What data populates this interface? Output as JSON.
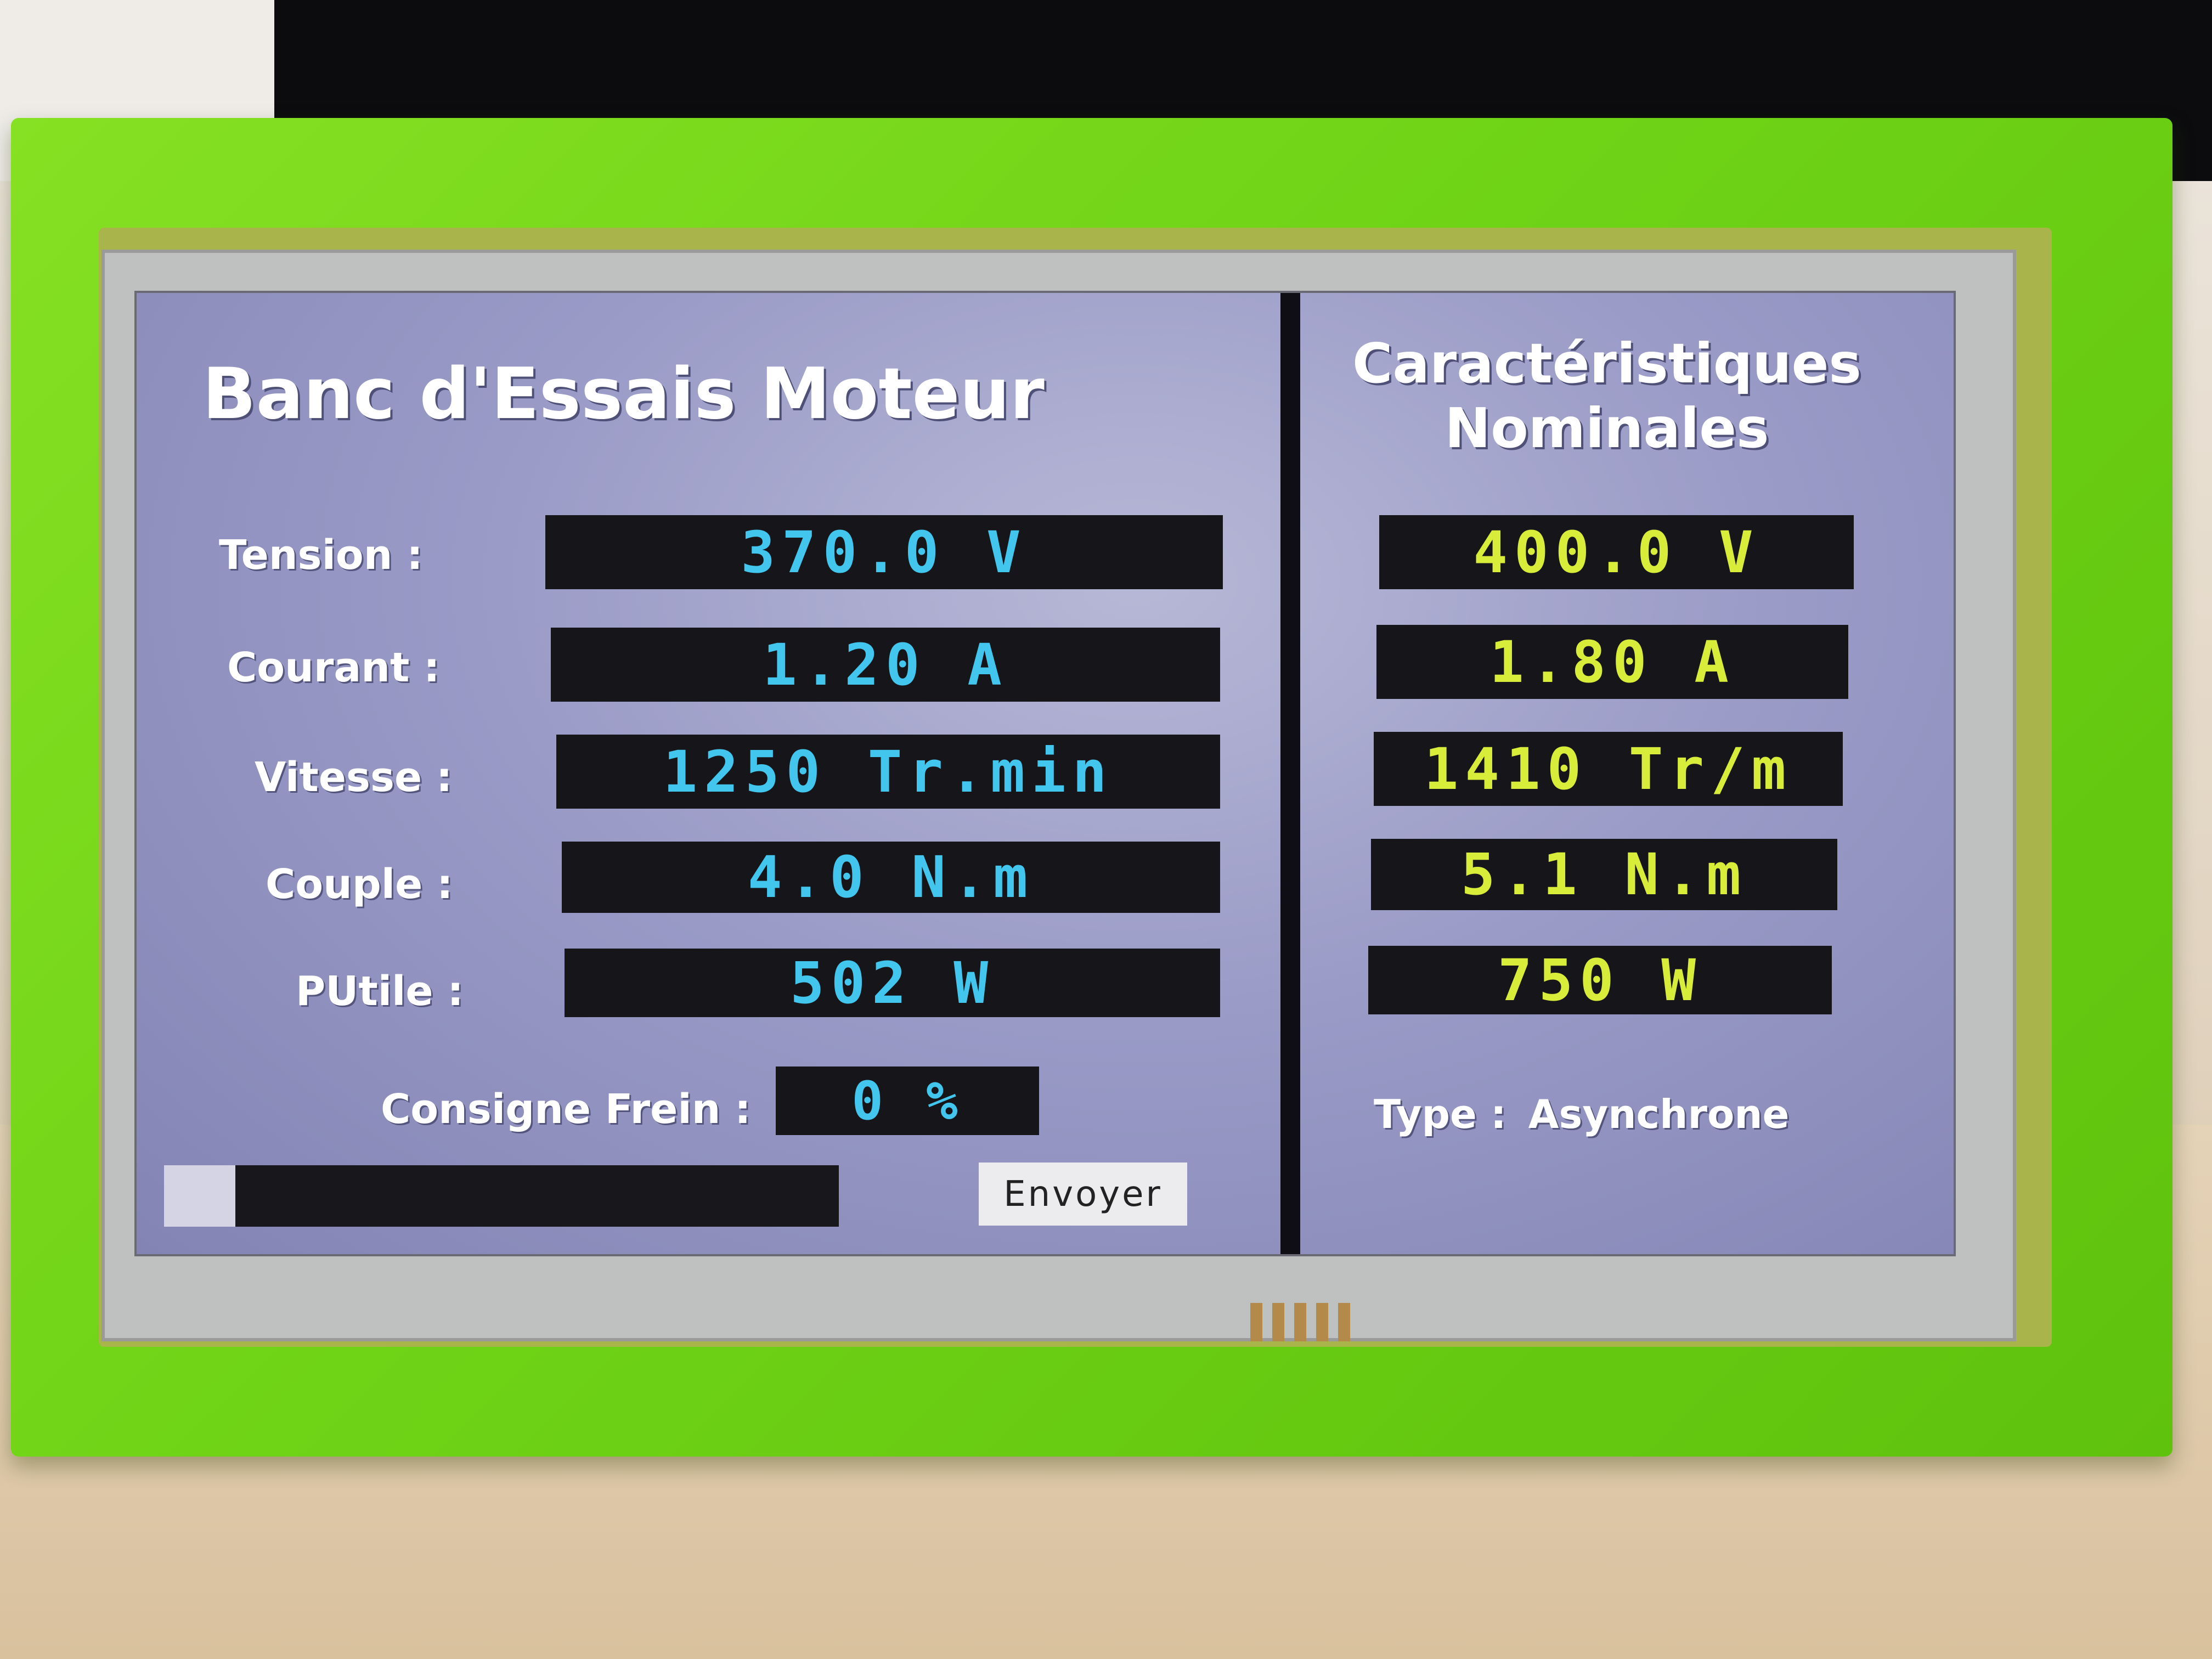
{
  "app": {
    "title": "Banc d'Essais Moteur",
    "side_title_line1": "Caractéristiques",
    "side_title_line2": "Nominales"
  },
  "measured": {
    "tension": {
      "label": "Tension :",
      "value": "370.0 V"
    },
    "courant": {
      "label": "Courant :",
      "value": "1.20 A"
    },
    "vitesse": {
      "label": "Vitesse :",
      "value": "1250 Tr.min"
    },
    "couple": {
      "label": "Couple :",
      "value": "4.0 N.m"
    },
    "putile": {
      "label": "PUtile :",
      "value": "502 W"
    }
  },
  "nominal": {
    "tension": "400.0 V",
    "courant": "1.80 A",
    "vitesse": "1410 Tr/m",
    "couple": "5.1 N.m",
    "putile": "750 W",
    "type_label": "Type :",
    "type_value": "Asynchrone"
  },
  "brake": {
    "label": "Consigne Frein :",
    "value": "0 %",
    "slider_level": 0,
    "send_label": "Envoyer"
  },
  "colors": {
    "frame": "#6fd316",
    "screen_background": "#9a9bc7",
    "measured_text": "#43c6ee",
    "nominal_text": "#d8ec3a",
    "field_background": "#16161a"
  }
}
